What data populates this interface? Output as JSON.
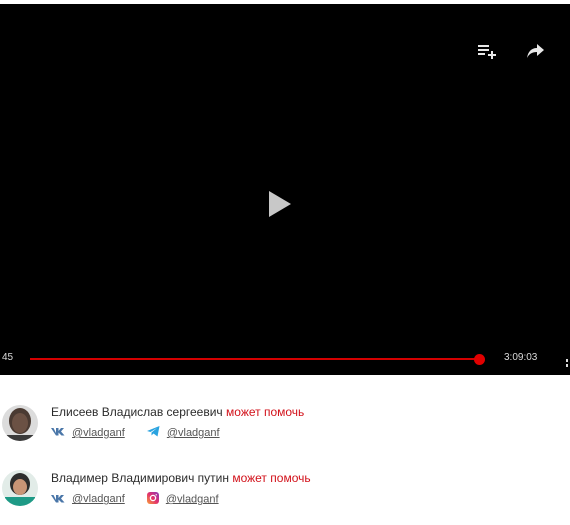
{
  "player": {
    "current_time": "45",
    "total_time": "3:09:03",
    "progress": 0.97,
    "icons": {
      "playlist": "playlist-add-icon",
      "share": "share-icon",
      "play": "play-icon"
    },
    "accent_color": "#e10000"
  },
  "comments": [
    {
      "name": "Елисеев Владислав сергеевич",
      "help": "может помочь",
      "socials": [
        {
          "icon": "vk-icon",
          "handle": "@vladganf"
        },
        {
          "icon": "telegram-icon",
          "handle": "@vladganf"
        }
      ]
    },
    {
      "name": "Владимер Владимирович путин",
      "help": "может помочь",
      "socials": [
        {
          "icon": "vk-icon",
          "handle": "@vladganf"
        },
        {
          "icon": "instagram-icon",
          "handle": "@vladganf"
        }
      ]
    }
  ],
  "colors": {
    "help_text": "#d2111a",
    "vk": "#4a76a8",
    "telegram": "#2aa3e0"
  }
}
